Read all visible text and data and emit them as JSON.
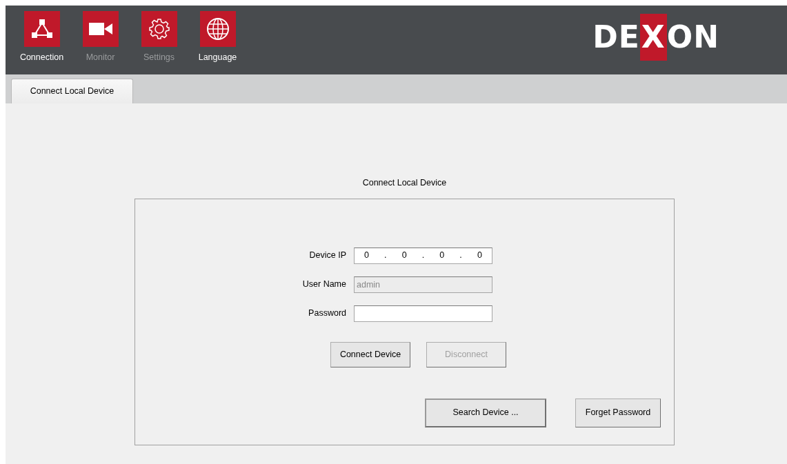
{
  "toolbar": [
    {
      "label": "Connection",
      "kind": "network",
      "disabled": false
    },
    {
      "label": "Monitor",
      "kind": "camera",
      "disabled": true
    },
    {
      "label": "Settings",
      "kind": "gear",
      "disabled": true
    },
    {
      "label": "Language",
      "kind": "globe",
      "disabled": false
    }
  ],
  "logo": {
    "before": "DE",
    "highlight": "X",
    "after": "ON"
  },
  "tabs": [
    {
      "label": "Connect Local Device",
      "selected": true
    }
  ],
  "group": {
    "title": "Connect Local Device",
    "fields": [
      {
        "kind": "ip",
        "label": "Device IP",
        "octets": [
          "0",
          "0",
          "0",
          "0"
        ],
        "separator": ".",
        "disabled": false
      },
      {
        "kind": "text",
        "label": "User Name",
        "value": "admin",
        "disabled": true
      },
      {
        "kind": "password",
        "label": "Password",
        "disabled": false
      }
    ],
    "buttons": [
      {
        "label": "Connect Device",
        "disabled": false,
        "default": false
      },
      {
        "label": "Disconnect",
        "disabled": true,
        "default": false
      }
    ],
    "bottom_buttons": [
      {
        "label": "Search Device ...",
        "disabled": false,
        "default": true
      },
      {
        "label": "Forget Password",
        "disabled": false,
        "default": false
      }
    ]
  }
}
